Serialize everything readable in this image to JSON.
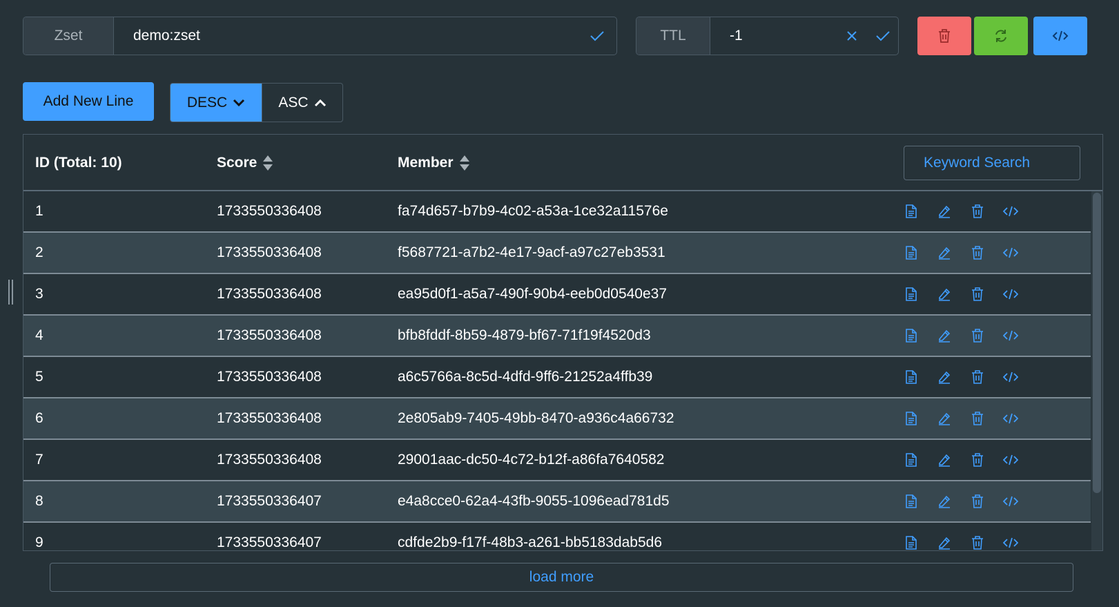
{
  "key": {
    "type_label": "Zset",
    "name": "demo:zset"
  },
  "ttl": {
    "label": "TTL",
    "value": "-1"
  },
  "toolbar": {
    "add_label": "Add New Line",
    "desc_label": "DESC",
    "asc_label": "ASC",
    "delete_icon": "trash-icon",
    "refresh_icon": "refresh-icon",
    "code_icon": "code-icon"
  },
  "colors": {
    "background": "#263238",
    "row_alt": "#37474f",
    "primary": "#409eff",
    "danger": "#f56c6c",
    "success": "#67c23a"
  },
  "table": {
    "headers": {
      "id": "ID (Total: 10)",
      "score": "Score",
      "member": "Member"
    },
    "search_placeholder": "Keyword Search",
    "row_action_icons": [
      "document-icon",
      "edit-icon",
      "trash-icon",
      "code-icon"
    ],
    "rows": [
      {
        "id": "1",
        "score": "1733550336408",
        "member": "fa74d657-b7b9-4c02-a53a-1ce32a11576e"
      },
      {
        "id": "2",
        "score": "1733550336408",
        "member": "f5687721-a7b2-4e17-9acf-a97c27eb3531"
      },
      {
        "id": "3",
        "score": "1733550336408",
        "member": "ea95d0f1-a5a7-490f-90b4-eeb0d0540e37"
      },
      {
        "id": "4",
        "score": "1733550336408",
        "member": "bfb8fddf-8b59-4879-bf67-71f19f4520d3"
      },
      {
        "id": "5",
        "score": "1733550336408",
        "member": "a6c5766a-8c5d-4dfd-9ff6-21252a4ffb39"
      },
      {
        "id": "6",
        "score": "1733550336408",
        "member": "2e805ab9-7405-49bb-8470-a936c4a66732"
      },
      {
        "id": "7",
        "score": "1733550336408",
        "member": "29001aac-dc50-4c72-b12f-a86fa7640582"
      },
      {
        "id": "8",
        "score": "1733550336407",
        "member": "e4a8cce0-62a4-43fb-9055-1096ead781d5"
      },
      {
        "id": "9",
        "score": "1733550336407",
        "member": "cdfde2b9-f17f-48b3-a261-bb5183dab5d6"
      }
    ]
  },
  "load_more_label": "load more"
}
